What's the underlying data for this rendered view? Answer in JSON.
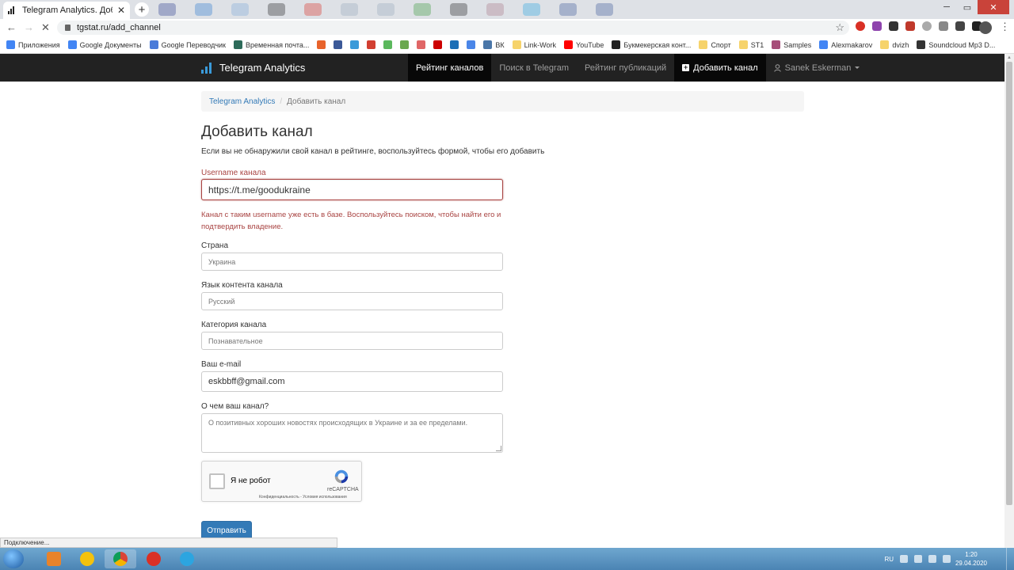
{
  "browser": {
    "tab_title": "Telegram Analytics. Добавить ка...",
    "tab_close": "✕",
    "new_tab": "+",
    "url": "tgstat.ru/add_channel",
    "win_min": "─",
    "win_max": "▭",
    "win_close": "✕",
    "back": "←",
    "forward": "→",
    "reload": "✕",
    "star": "☆",
    "menu": "⋮"
  },
  "bookmarks": [
    {
      "label": "Приложения",
      "color": "#4285f4"
    },
    {
      "label": "Google Документы",
      "color": "#4285f4"
    },
    {
      "label": "Google Переводчик",
      "color": "#4a7bd9"
    },
    {
      "label": "Временная почта...",
      "color": "#2d6b5a"
    },
    {
      "label": "",
      "color": "#e8632b"
    },
    {
      "label": "",
      "color": "#3b5998"
    },
    {
      "label": "",
      "color": "#3a9ad9"
    },
    {
      "label": "",
      "color": "#d23f31"
    },
    {
      "label": "",
      "color": "#5bb85d"
    },
    {
      "label": "",
      "color": "#6aa84f"
    },
    {
      "label": "",
      "color": "#e06666"
    },
    {
      "label": "",
      "color": "#cc0000"
    },
    {
      "label": "",
      "color": "#1c6fb6"
    },
    {
      "label": "",
      "color": "#4a86e8"
    },
    {
      "label": "ВК",
      "color": "#4a76a8"
    },
    {
      "label": "Link-Work",
      "color": "#f6d36b"
    },
    {
      "label": "YouTube",
      "color": "#ff0000"
    },
    {
      "label": "Букмекерская конт...",
      "color": "#222222"
    },
    {
      "label": "Спорт",
      "color": "#f6d36b"
    },
    {
      "label": "ST1",
      "color": "#f6d36b"
    },
    {
      "label": "Samples",
      "color": "#a64d79"
    },
    {
      "label": "Alexmakarov",
      "color": "#4285f4"
    },
    {
      "label": "dvizh",
      "color": "#f6d36b"
    },
    {
      "label": "Soundcloud Mp3 D...",
      "color": "#333333"
    }
  ],
  "site": {
    "brand": "Telegram Analytics",
    "nav": [
      {
        "label": "Рейтинг каналов",
        "active": true
      },
      {
        "label": "Поиск в Telegram",
        "active": false
      },
      {
        "label": "Рейтинг публикаций",
        "active": false
      }
    ],
    "add_channel": "Добавить канал",
    "user": "Sanek Eskerman"
  },
  "breadcrumb": {
    "home": "Telegram Analytics",
    "separator": "/",
    "current": "Добавить канал"
  },
  "form": {
    "heading": "Добавить канал",
    "intro": "Если вы не обнаружили свой канал в рейтинге, воспользуйтесь формой, чтобы его добавить",
    "username_label": "Username канала",
    "username_value": "https://t.me/goodukraine",
    "username_error": "Канал с таким username уже есть в базе. Воспользуйтесь поиском, чтобы найти его и подтвердить владение.",
    "country_label": "Страна",
    "country_value": "Украина",
    "language_label": "Язык контента канала",
    "language_value": "Русский",
    "category_label": "Категория канала",
    "category_value": "Познавательное",
    "email_label": "Ваш e-mail",
    "email_value": "eskbbff@gmail.com",
    "about_label": "О чем ваш канал?",
    "about_value": "О позитивных хороших новостях происходящих в Украине и за ее пределами.",
    "captcha_text": "Я не робот",
    "captcha_brand": "reCAPTCHA",
    "captcha_terms": "Конфиденциальность - Условия использования",
    "submit": "Отправить"
  },
  "status_text": "Подключение...",
  "taskbar": {
    "lang": "RU",
    "time": "1:20",
    "date": "29.04.2020"
  },
  "colors": {
    "accent": "#337ab7",
    "error": "#a94442",
    "navbar": "#222222"
  }
}
